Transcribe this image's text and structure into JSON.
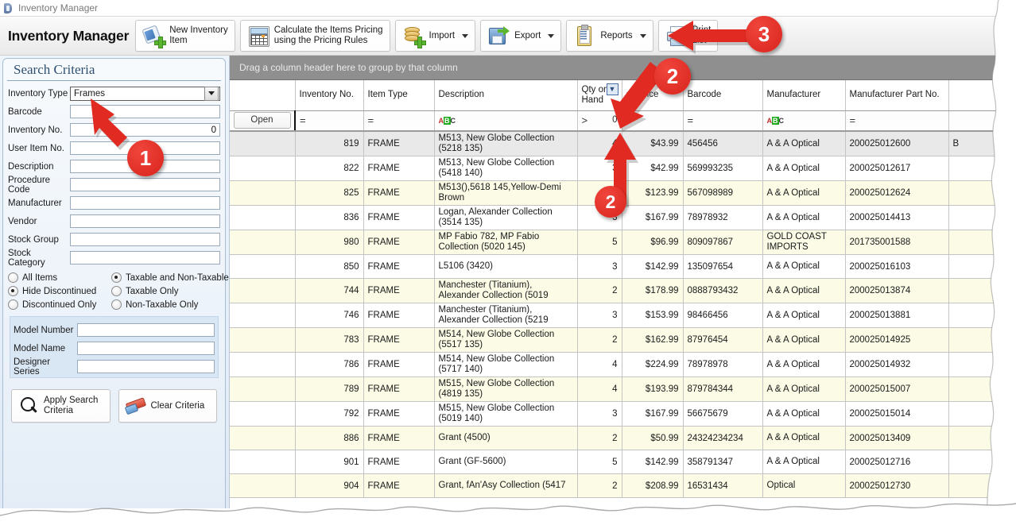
{
  "window": {
    "title": "Inventory Manager",
    "icon": "app-icon"
  },
  "header": {
    "app_title": "Inventory Manager"
  },
  "toolbar": {
    "buttons": [
      {
        "id": "new-inventory-item",
        "label_line1": "New Inventory",
        "label_line2": "Item",
        "icon": "tag-plus-icon",
        "dropdown": false
      },
      {
        "id": "calculate-pricing",
        "label_line1": "Calculate the Items Pricing",
        "label_line2": "using the Pricing Rules",
        "icon": "calculator-icon",
        "dropdown": false
      },
      {
        "id": "import",
        "label_line1": "Import",
        "label_line2": "",
        "icon": "database-plus-icon",
        "dropdown": true
      },
      {
        "id": "export",
        "label_line1": "Export",
        "label_line2": "",
        "icon": "floppy-arrow-icon",
        "dropdown": true
      },
      {
        "id": "reports",
        "label_line1": "Reports",
        "label_line2": "",
        "icon": "clipboard-icon",
        "dropdown": true
      },
      {
        "id": "print-list",
        "label_line1": "Print",
        "label_line2": "List",
        "icon": "printer-icon",
        "dropdown": false
      }
    ]
  },
  "search_panel": {
    "title": "Search Criteria",
    "inventory_type": {
      "label": "Inventory Type",
      "value": "Frames"
    },
    "fields": [
      {
        "label": "Barcode",
        "value": "",
        "align": "left"
      },
      {
        "label": "Inventory No.",
        "value": "0",
        "align": "right"
      },
      {
        "label": "User Item No.",
        "value": "",
        "align": "left"
      },
      {
        "label": "Description",
        "value": "",
        "align": "left"
      },
      {
        "label": "Procedure Code",
        "value": "",
        "align": "left"
      },
      {
        "label": "Manufacturer",
        "value": "",
        "align": "left"
      },
      {
        "label": "Vendor",
        "value": "",
        "align": "left"
      },
      {
        "label": "Stock Group",
        "value": "",
        "align": "left"
      },
      {
        "label": "Stock Category",
        "value": "",
        "align": "left"
      }
    ],
    "radios_left": [
      {
        "label": "All Items",
        "selected": false
      },
      {
        "label": "Hide Discontinued",
        "selected": true
      },
      {
        "label": "Discontinued Only",
        "selected": false
      }
    ],
    "radios_right": [
      {
        "label": "Taxable and Non-Taxable",
        "selected": true
      },
      {
        "label": "Taxable Only",
        "selected": false
      },
      {
        "label": "Non-Taxable Only",
        "selected": false
      }
    ],
    "sub_fields": [
      {
        "label": "Model Number",
        "value": ""
      },
      {
        "label": "Model Name",
        "value": ""
      },
      {
        "label": "Designer Series",
        "value": ""
      }
    ],
    "apply_button": {
      "line1": "Apply Search",
      "line2": "Criteria",
      "icon": "magnifier-icon"
    },
    "clear_button": {
      "line1": "Clear Criteria",
      "line2": "",
      "icon": "eraser-icon"
    }
  },
  "grid": {
    "group_bar_text": "Drag a column header here to group by that column",
    "columns": [
      {
        "key": "open",
        "label": ""
      },
      {
        "key": "inv",
        "label": "Inventory No."
      },
      {
        "key": "type",
        "label": "Item Type"
      },
      {
        "key": "desc",
        "label": "Description"
      },
      {
        "key": "qty",
        "label": "Qty on Hand",
        "filter_icon": "funnel-icon"
      },
      {
        "key": "price",
        "label": "ail Price"
      },
      {
        "key": "bar",
        "label": "Barcode"
      },
      {
        "key": "man",
        "label": "Manufacturer"
      },
      {
        "key": "part",
        "label": "Manufacturer Part No."
      },
      {
        "key": "extra",
        "label": ""
      }
    ],
    "filter_row": {
      "open_button": "Open",
      "inv": "=",
      "type": "=",
      "desc": "ABC",
      "qty_operator": ">",
      "qty_value": "0",
      "price_operator": ">",
      "bar": "=",
      "man": "ABC",
      "part": "="
    },
    "rows": [
      {
        "inv": "819",
        "type": "FRAME",
        "desc": "M513, New Globe Collection (5218 135)",
        "qty": "4",
        "price": "$43.99",
        "bar": "456456",
        "man": "A & A Optical",
        "part": "200025012600",
        "extra": "B",
        "style": "sel"
      },
      {
        "inv": "822",
        "type": "FRAME",
        "desc": "M513, New Globe Collection (5418 140)",
        "qty": "3",
        "price": "$42.99",
        "bar": "569993235",
        "man": "A & A Optical",
        "part": "200025012617",
        "extra": "",
        "style": ""
      },
      {
        "inv": "825",
        "type": "FRAME",
        "desc": "M513(),5618 145,Yellow-Demi Brown",
        "qty": "5",
        "price": "$123.99",
        "bar": "567098989",
        "man": "A & A Optical",
        "part": "200025012624",
        "extra": "",
        "style": "alt"
      },
      {
        "inv": "836",
        "type": "FRAME",
        "desc": "Logan, Alexander Collection (3514 135)",
        "qty": "3",
        "price": "$167.99",
        "bar": "78978932",
        "man": "A & A Optical",
        "part": "200025014413",
        "extra": "",
        "style": ""
      },
      {
        "inv": "980",
        "type": "FRAME",
        "desc": "MP Fabio 782, MP Fabio Collection (5020  145)",
        "qty": "5",
        "price": "$96.99",
        "bar": "809097867",
        "man": "GOLD COAST IMPORTS",
        "part": "201735001588",
        "extra": "",
        "style": "alt"
      },
      {
        "inv": "850",
        "type": "FRAME",
        "desc": "L5106 (3420)",
        "qty": "3",
        "price": "$142.99",
        "bar": "135097654",
        "man": "A & A Optical",
        "part": "200025016103",
        "extra": "",
        "style": ""
      },
      {
        "inv": "744",
        "type": "FRAME",
        "desc": "Manchester (Titanium), Alexander Collection (5019",
        "qty": "2",
        "price": "$178.99",
        "bar": "0888793432",
        "man": "A & A Optical",
        "part": "200025013874",
        "extra": "",
        "style": "alt"
      },
      {
        "inv": "746",
        "type": "FRAME",
        "desc": "Manchester (Titanium), Alexander Collection (5219",
        "qty": "3",
        "price": "$153.99",
        "bar": "98466456",
        "man": "A & A Optical",
        "part": "200025013881",
        "extra": "",
        "style": ""
      },
      {
        "inv": "783",
        "type": "FRAME",
        "desc": "M514, New Globe Collection (5517 135)",
        "qty": "2",
        "price": "$162.99",
        "bar": "87976454",
        "man": "A & A Optical",
        "part": "200025014925",
        "extra": "",
        "style": "alt"
      },
      {
        "inv": "786",
        "type": "FRAME",
        "desc": "M514, New Globe Collection (5717 140)",
        "qty": "4",
        "price": "$224.99",
        "bar": "78978978",
        "man": "A & A Optical",
        "part": "200025014932",
        "extra": "",
        "style": ""
      },
      {
        "inv": "789",
        "type": "FRAME",
        "desc": "M515, New Globe Collection (4819 135)",
        "qty": "4",
        "price": "$193.99",
        "bar": "879784344",
        "man": "A & A Optical",
        "part": "200025015007",
        "extra": "",
        "style": "alt"
      },
      {
        "inv": "792",
        "type": "FRAME",
        "desc": "M515, New Globe Collection (5019 140)",
        "qty": "3",
        "price": "$167.99",
        "bar": "56675679",
        "man": "A & A Optical",
        "part": "200025015014",
        "extra": "",
        "style": ""
      },
      {
        "inv": "886",
        "type": "FRAME",
        "desc": "Grant (4500)",
        "qty": "2",
        "price": "$50.99",
        "bar": "24324234234",
        "man": "A & A Optical",
        "part": "200025013409",
        "extra": "",
        "style": "alt"
      },
      {
        "inv": "901",
        "type": "FRAME",
        "desc": "Grant (GF-5600)",
        "qty": "5",
        "price": "$142.99",
        "bar": "358791347",
        "man": "A & A Optical",
        "part": "200025012716",
        "extra": "",
        "style": ""
      },
      {
        "inv": "904",
        "type": "FRAME",
        "desc": "Grant, fAn'Asy Collection (5417",
        "qty": "2",
        "price": "$208.99",
        "bar": "16531434",
        "man": "Optical",
        "part": "200025012730",
        "extra": "",
        "style": "alt"
      }
    ]
  },
  "callouts": [
    {
      "number": "1"
    },
    {
      "number": "2"
    },
    {
      "number": "2"
    },
    {
      "number": "3"
    }
  ],
  "colors": {
    "accent_red": "#d8241c",
    "grid_alt_row": "#fbfbe6",
    "group_bar": "#8f8f8f"
  }
}
